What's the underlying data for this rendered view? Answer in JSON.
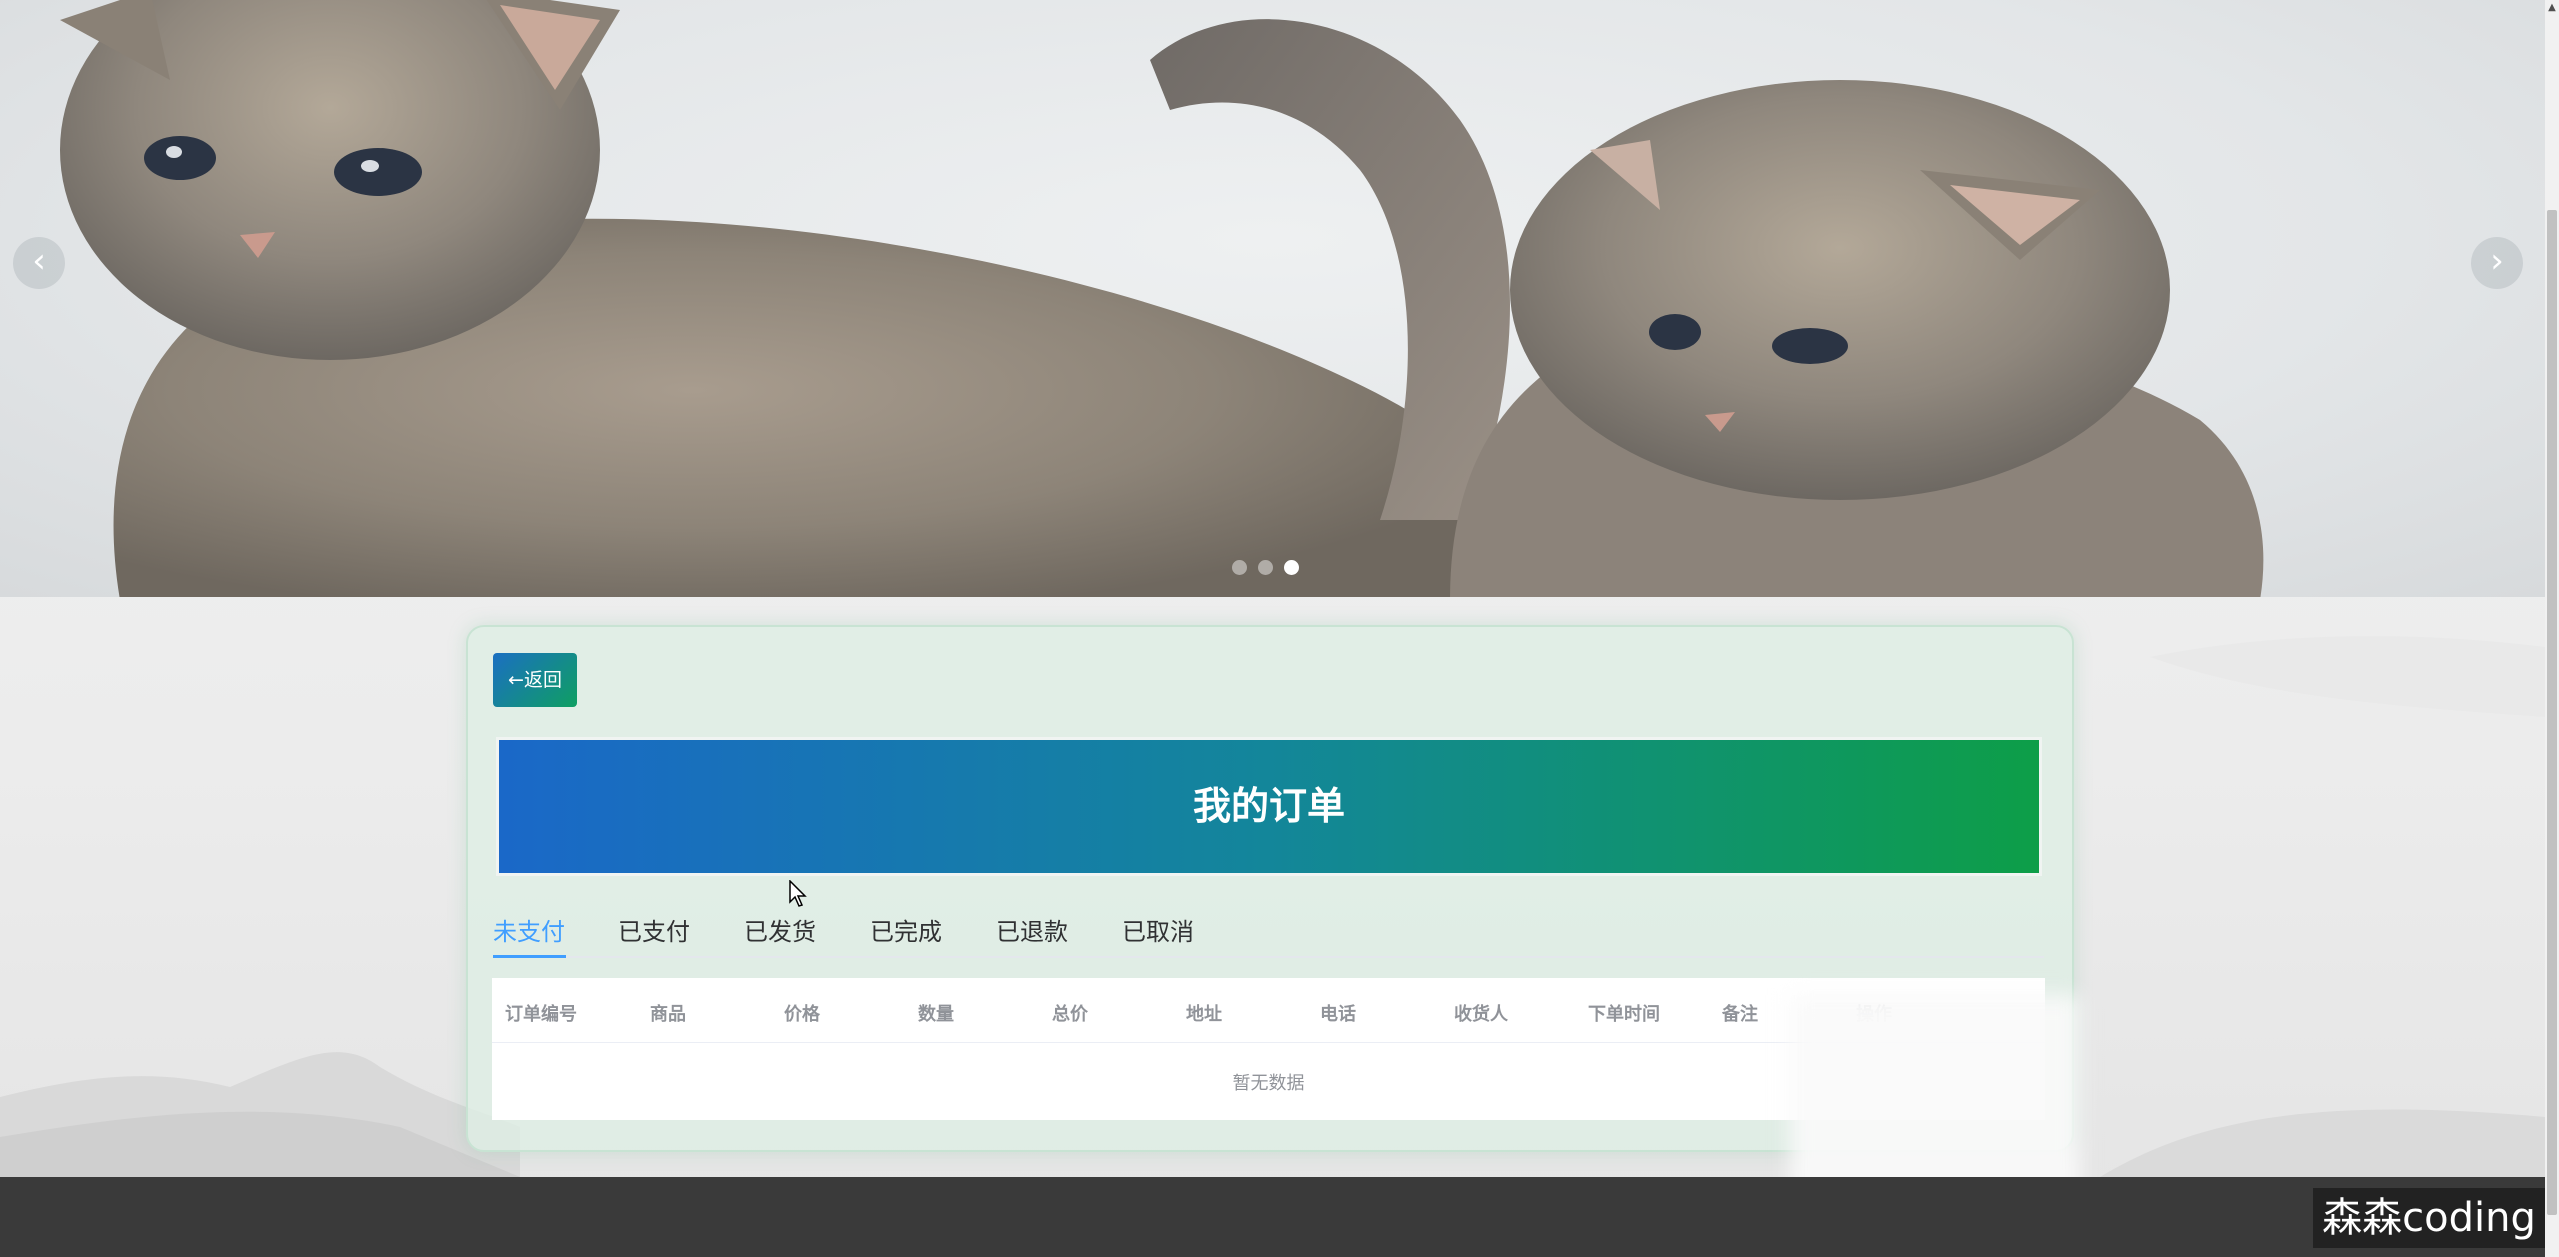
{
  "carousel": {
    "prev_symbol": "‹",
    "next_symbol": "›",
    "slide_count": 3,
    "active_slide": 3,
    "image_subject": "two grey kittens"
  },
  "back_button": {
    "label": "←返回"
  },
  "page_title": "我的订单",
  "tabs": [
    {
      "label": "未支付",
      "active": true
    },
    {
      "label": "已支付",
      "active": false
    },
    {
      "label": "已发货",
      "active": false
    },
    {
      "label": "已完成",
      "active": false
    },
    {
      "label": "已退款",
      "active": false
    },
    {
      "label": "已取消",
      "active": false
    }
  ],
  "table": {
    "columns": [
      "订单编号",
      "商品",
      "价格",
      "数量",
      "总价",
      "地址",
      "电话",
      "收货人",
      "下单时间",
      "备注",
      "操作"
    ],
    "empty_text": "暂无数据"
  },
  "watermark": "森森coding",
  "colors": {
    "accent_blue": "#409eff",
    "gradient_start": "#1a68c8",
    "gradient_end": "#0d9e48",
    "footer": "#3a3a3a"
  }
}
